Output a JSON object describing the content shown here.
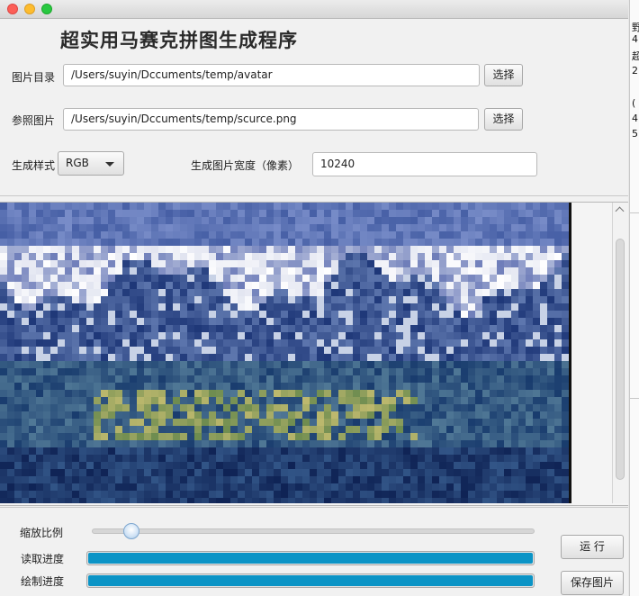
{
  "window": {
    "title": ""
  },
  "app": {
    "title": "超实用马赛克拼图生成程序"
  },
  "form": {
    "image_dir": {
      "label": "图片目录",
      "value": "/Users/suyin/Dccuments/temp/avatar",
      "button": "选择"
    },
    "reference": {
      "label": "参照图片",
      "value": "/Users/suyin/Dccuments/temp/scurce.png",
      "button": "选择"
    },
    "style": {
      "label": "生成样式",
      "selected": "RGB"
    },
    "width": {
      "label": "生成图片宽度（像素）",
      "value": "10240"
    }
  },
  "controls": {
    "zoom": {
      "label": "缩放比例",
      "value": 0.07
    },
    "read_progress": {
      "label": "读取进度",
      "value": 1.0
    },
    "draw_progress": {
      "label": "绘制进度",
      "value": 1.0
    },
    "run_button": "运 行",
    "save_button": "保存图片"
  },
  "side_panel": {
    "fragments": [
      "野",
      "4",
      "超",
      "2",
      "(",
      "4",
      "5"
    ]
  },
  "colors": {
    "progress_fill": "#0b94c6",
    "slider_accent": "#7ea7cf"
  }
}
